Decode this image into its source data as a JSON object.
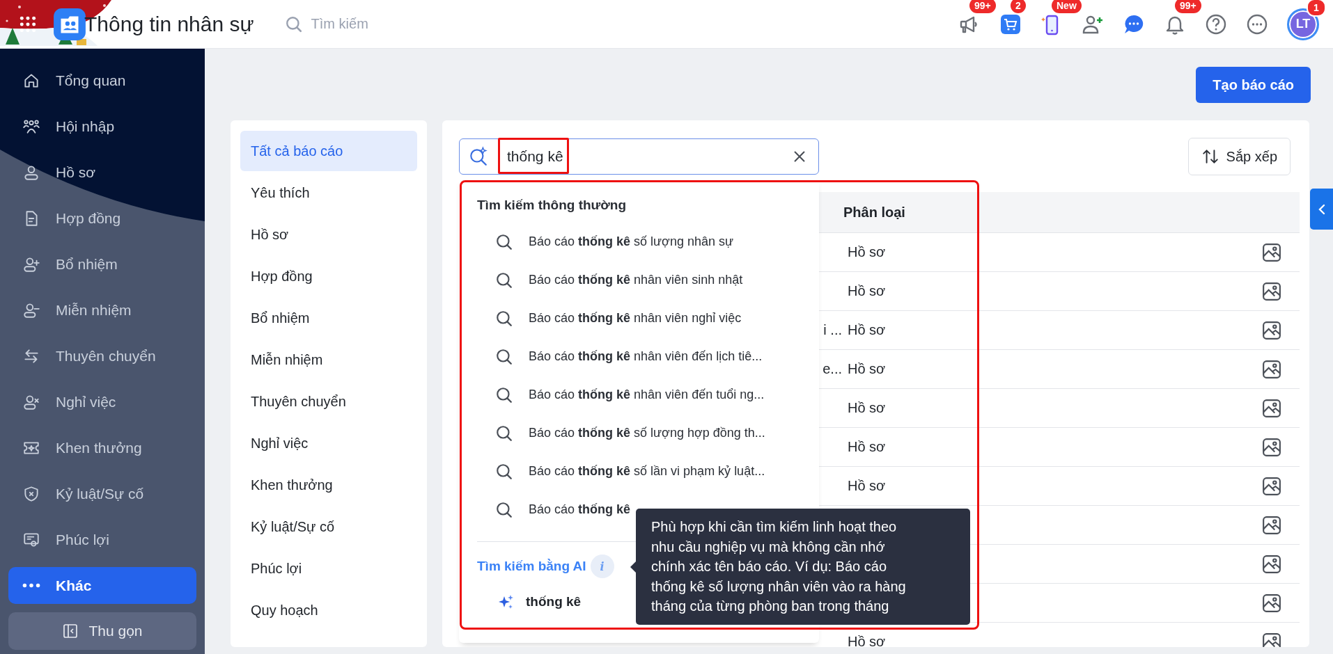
{
  "header": {
    "title": "Thông tin nhân sự",
    "search_placeholder": "Tìm kiếm",
    "actions": [
      {
        "kind": "megaphone",
        "badge": "99+"
      },
      {
        "kind": "cart",
        "badge": "2"
      },
      {
        "kind": "phone",
        "badge": "New"
      },
      {
        "kind": "add-user"
      },
      {
        "kind": "chat"
      },
      {
        "kind": "bell",
        "badge": "99+"
      },
      {
        "kind": "help"
      },
      {
        "kind": "more"
      }
    ],
    "avatar": {
      "initials": "LT",
      "badge": "1"
    }
  },
  "sidebar": {
    "items": [
      {
        "label": "Tổng quan",
        "selected": false
      },
      {
        "label": "Hội nhập",
        "selected": false
      },
      {
        "label": "Hồ sơ",
        "selected": false
      },
      {
        "label": "Hợp đồng",
        "selected": false
      },
      {
        "label": "Bổ nhiệm",
        "selected": false
      },
      {
        "label": "Miễn nhiệm",
        "selected": false
      },
      {
        "label": "Thuyên chuyển",
        "selected": false
      },
      {
        "label": "Nghỉ việc",
        "selected": false
      },
      {
        "label": "Khen thưởng",
        "selected": false
      },
      {
        "label": "Kỷ luật/Sự cố",
        "selected": false
      },
      {
        "label": "Phúc lợi",
        "selected": false
      },
      {
        "label": "Khác",
        "selected": true
      }
    ],
    "collapse_button": "Thu gọn"
  },
  "create_button": "Tạo báo cáo",
  "categories": [
    {
      "label": "Tất cả báo cáo",
      "selected": true
    },
    {
      "label": "Yêu thích",
      "selected": false
    },
    {
      "label": "Hồ sơ",
      "selected": false
    },
    {
      "label": "Hợp đồng",
      "selected": false
    },
    {
      "label": "Bổ nhiệm",
      "selected": false
    },
    {
      "label": "Miễn nhiệm",
      "selected": false
    },
    {
      "label": "Thuyên chuyển",
      "selected": false
    },
    {
      "label": "Nghỉ việc",
      "selected": false
    },
    {
      "label": "Khen thưởng",
      "selected": false
    },
    {
      "label": "Kỷ luật/Sự cố",
      "selected": false
    },
    {
      "label": "Phúc lợi",
      "selected": false
    },
    {
      "label": "Quy hoạch",
      "selected": false
    }
  ],
  "search": {
    "value": "thống kê"
  },
  "sort_button": "Sắp xếp",
  "table": {
    "category_header": "Phân loại",
    "rows": [
      {
        "category": "Hồ sơ"
      },
      {
        "category": "Hồ sơ"
      },
      {
        "column_1": "i ...",
        "category": "Hồ sơ"
      },
      {
        "column_1": "e...",
        "category": "Hồ sơ"
      },
      {
        "category": "Hồ sơ"
      },
      {
        "category": "Hồ sơ"
      },
      {
        "category": "Hồ sơ"
      },
      {},
      {},
      {},
      {
        "category": "Hồ sơ"
      }
    ]
  },
  "dropdown": {
    "heading": "Tìm kiếm thông thường",
    "suggestions": [
      "Báo cáo **thống kê** số lượng nhân sự",
      "Báo cáo **thống kê** nhân viên sinh nhật",
      "Báo cáo **thống kê** nhân viên nghỉ việc",
      "Báo cáo **thống kê** nhân viên đến lịch tiê...",
      "Báo cáo **thống kê** nhân viên đến tuổi ng...",
      "Báo cáo **thống kê** số lượng hợp đồng th...",
      "Báo cáo **thống kê** số lần vi phạm kỷ luật...",
      "Báo cáo **thống kê**"
    ],
    "ai_heading": "Tìm kiếm bằng AI",
    "ai_info_glyph": "i",
    "ai_suggestion": "thống kê"
  },
  "tooltip": {
    "text": "Phù hợp khi cần tìm kiếm linh hoạt theo nhu cầu nghiệp vụ mà không cần nhớ chính xác tên báo cáo. Ví dụ: Báo cáo thống kê số lượng nhân viên vào ra hàng tháng của từng phòng ban trong tháng"
  }
}
